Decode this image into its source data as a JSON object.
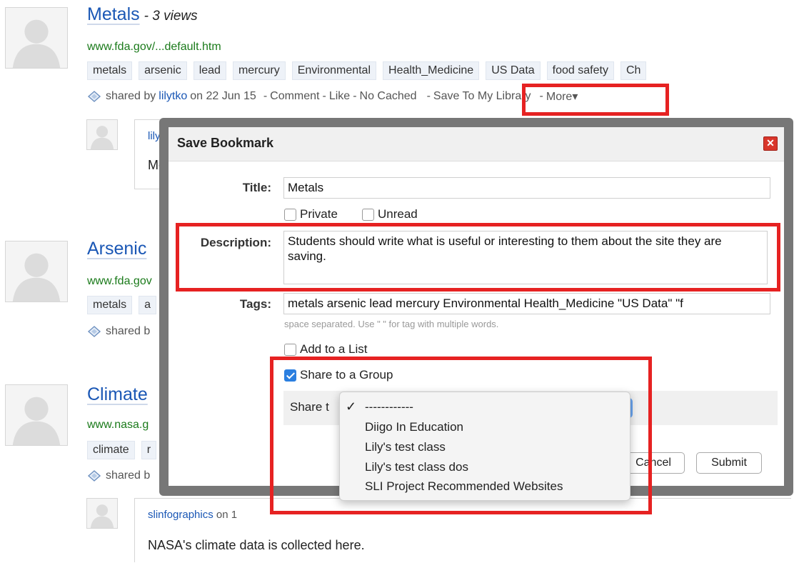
{
  "items": [
    {
      "title": "Metals",
      "views": "- 3 views",
      "url": "www.fda.gov/...default.htm",
      "tags": [
        "metals",
        "arsenic",
        "lead",
        "mercury",
        "Environmental",
        "Health_Medicine",
        "US Data",
        "food safety",
        "Ch"
      ],
      "shared_by_prefix": "shared by",
      "user": "lilytko",
      "date": "on 22 Jun 15",
      "actions": {
        "comment": "Comment",
        "like": "Like",
        "no_cached": "No Cached",
        "save": "Save To My Library",
        "more": "More▾",
        "dash": "-"
      },
      "comment_user": "lily",
      "comment_text": "Me"
    },
    {
      "title": "Arsenic",
      "url": "www.fda.gov",
      "tags": [
        "metals",
        "a"
      ],
      "shared_by_prefix": "shared b"
    },
    {
      "title": "Climate",
      "url": "www.nasa.g",
      "tags": [
        "climate",
        "r"
      ],
      "shared_by_prefix": "shared b",
      "comment_user": "slinfographics",
      "comment_date": "on 1",
      "comment_text": "NASA's climate data is collected here."
    }
  ],
  "modal": {
    "title": "Save Bookmark",
    "close_icon": "close-icon",
    "title_label": "Title:",
    "title_value": "Metals",
    "private_label": "Private",
    "unread_label": "Unread",
    "private_checked": false,
    "unread_checked": false,
    "description_label": "Description:",
    "description_value": "Students should write what is useful or interesting to them about the site they are saving.",
    "tags_label": "Tags:",
    "tags_value": "metals arsenic lead mercury Environmental Health_Medicine \"US Data\" \"f",
    "tags_hint": "space separated. Use \" \" for tag with multiple words.",
    "add_to_list_label": "Add to a List",
    "add_to_list_checked": false,
    "share_group_label": "Share to a Group",
    "share_group_checked": true,
    "share_to_label": "Share t",
    "cancel_label": "Cancel",
    "submit_label": "Submit"
  },
  "dropdown": {
    "options": [
      "------------",
      "Diigo In Education",
      "Lily's test class",
      "Lily's test class dos",
      "SLI Project Recommended Websites"
    ],
    "selected": "------------",
    "check_glyph": "✓"
  },
  "colors": {
    "highlight": "#e62222",
    "link": "#1a57b5",
    "url": "#1a7a1a",
    "checkbox_accent": "#2b7fe0"
  }
}
